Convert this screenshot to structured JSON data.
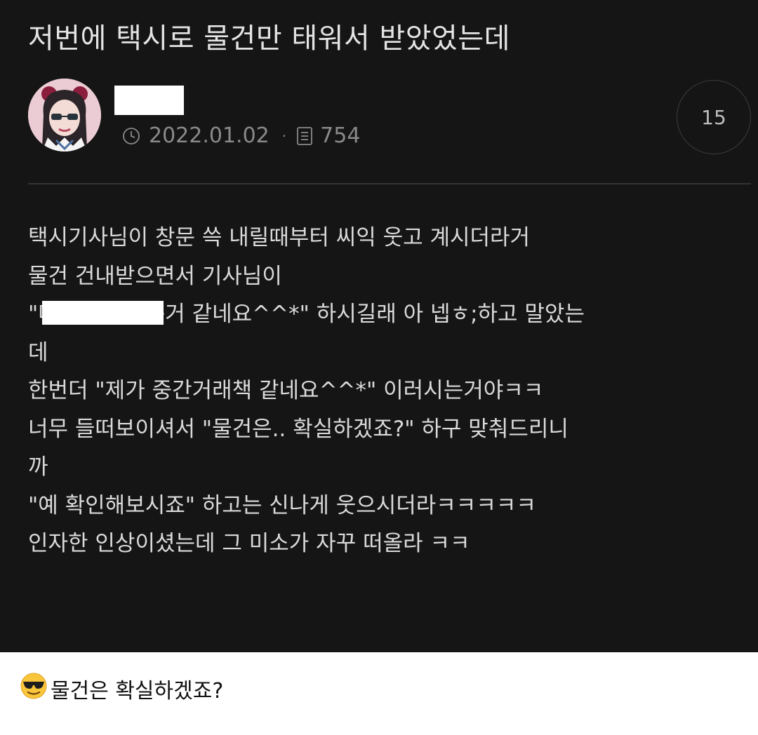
{
  "post": {
    "title": "저번에 택시로 물건만 태워서 받았었는데",
    "date": "2022.01.02",
    "separator": "·",
    "views": "754",
    "comment_count": "15",
    "icons": {
      "clock": "clock-icon",
      "views": "document-icon",
      "avatar": "avatar-image"
    },
    "lines": [
      "택시기사님이 창문 쓱 내릴때부터 씨익 웃고 계시더라거",
      "물건 건내받으면서 기사님이",
      "\"마약거래 하는거 같네요^^*\" 하시길래 아 넵ㅎ;하고 말았는",
      "데",
      "한번더 \"제가 중간거래책 같네요^^*\" 이러시는거야ㅋㅋ",
      "너무 들떠보이셔서 \"물건은.. 확실하겠죠?\" 하구 맞춰드리니",
      "까",
      "\"예 확인해보시죠\" 하고는 신나게 웃으시더라ㅋㅋㅋㅋㅋ",
      "인자한 인상이셨는데 그 미소가 자꾸 떠올라 ㅋㅋ"
    ]
  },
  "caption": {
    "emoji": "sunglasses-face-emoji",
    "text": "물건은 확실하겠죠?"
  },
  "colors": {
    "post_background": "#151515",
    "text": "#dadada",
    "meta_text": "#8a8a8a",
    "page_background": "#ffffff"
  }
}
